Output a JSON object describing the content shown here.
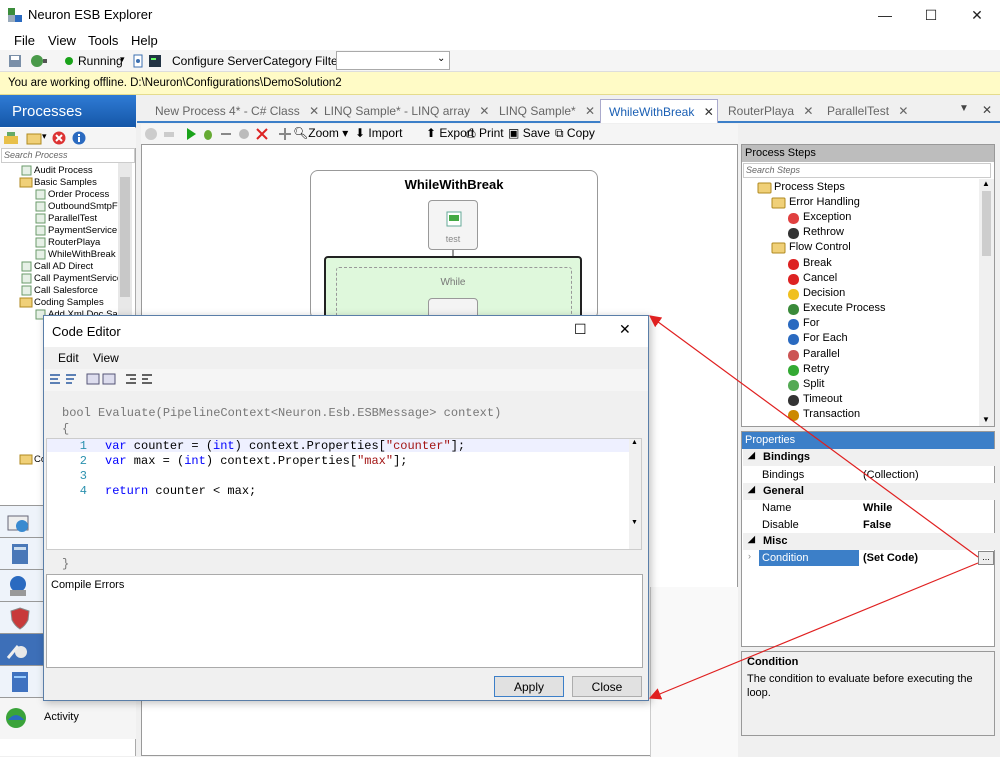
{
  "window": {
    "title": "Neuron ESB Explorer",
    "min": "—",
    "max": "☐",
    "close": "✕"
  },
  "menu": [
    "File",
    "View",
    "Tools",
    "Help"
  ],
  "toolbar": {
    "status": "Running",
    "configure_server": "Configure Server",
    "category_filter": "Category Filter",
    "filter_value": ""
  },
  "info": "You are working offline. D:\\Neuron\\Configurations\\DemoSolution2",
  "left": {
    "title": "Processes",
    "search_placeholder": "Search Process",
    "tree": [
      "Audit Process",
      "Basic Samples",
      "Order Process",
      "OutboundSmtpFile",
      "ParallelTest",
      "PaymentService",
      "RouterPlaya",
      "WhileWithBreak",
      "Call AD Direct",
      "Call PaymentService",
      "Call Salesforce",
      "Coding Samples",
      "Add Xml Doc Samp",
      "Co"
    ],
    "activity": "Activity"
  },
  "tabs": [
    "New Process 4* - C# Class",
    "LINQ Sample* - LINQ array",
    "LINQ Sample*",
    "WhileWithBreak",
    "RouterPlaya",
    "ParallelTest"
  ],
  "design_toolbar": {
    "zoom": "Zoom",
    "import": "Import",
    "export": "Export",
    "print": "Print",
    "save": "Save",
    "copy": "Copy"
  },
  "canvas": {
    "process_title": "WhileWithBreak",
    "step_label": "test",
    "while_label": "While"
  },
  "steps": {
    "header": "Process Steps",
    "search_placeholder": "Search Steps",
    "items": [
      "Process Steps",
      "Error Handling",
      "Exception",
      "Rethrow",
      "Flow Control",
      "Break",
      "Cancel",
      "Decision",
      "Execute Process",
      "For",
      "For Each",
      "Parallel",
      "Retry",
      "Split",
      "Timeout",
      "Transaction"
    ]
  },
  "properties": {
    "header": "Properties",
    "cat_bindings": "Bindings",
    "bindings_name": "Bindings",
    "bindings_value": "(Collection)",
    "cat_general": "General",
    "name_label": "Name",
    "name_value": "While",
    "disable_label": "Disable",
    "disable_value": "False",
    "cat_misc": "Misc",
    "condition_label": "Condition",
    "condition_value": "(Set Code)",
    "ellipsis": "..."
  },
  "description": {
    "title": "Condition",
    "text": "The condition to evaluate before executing the loop."
  },
  "dialog": {
    "title": "Code Editor",
    "menu": [
      "Edit",
      "View"
    ],
    "signature": "bool Evaluate(PipelineContext<Neuron.Esb.ESBMessage> context)",
    "open_brace": "{",
    "close_brace": "}",
    "line_numbers": [
      "1",
      "2",
      "3",
      "4"
    ],
    "errors_label": "Compile Errors",
    "apply": "Apply",
    "close": "Close"
  },
  "colors": {
    "accent": "#1a5fb4",
    "arrow": "#e02020",
    "while_bg": "#dff8dc"
  }
}
